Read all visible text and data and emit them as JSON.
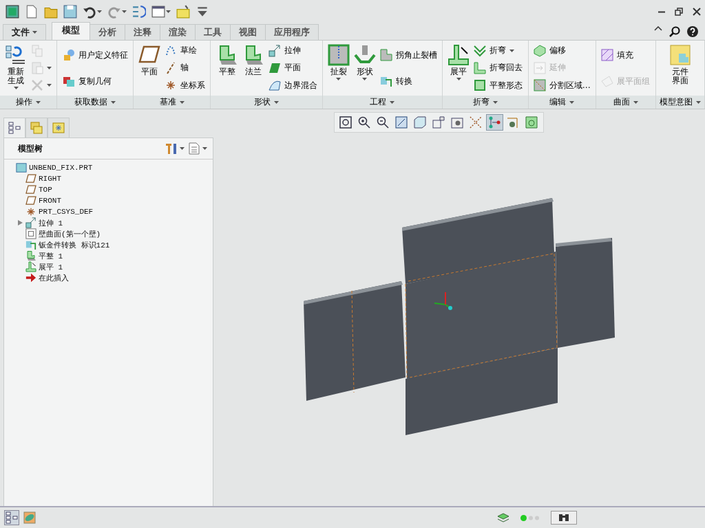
{
  "quick_access": {
    "buttons": [
      {
        "kind": "app",
        "dropdown": false
      },
      {
        "kind": "new",
        "dropdown": false
      },
      {
        "kind": "open",
        "dropdown": false
      },
      {
        "kind": "save",
        "dropdown": false
      },
      {
        "kind": "undo",
        "dropdown": true
      },
      {
        "kind": "redo",
        "dropdown": true
      },
      {
        "kind": "regen",
        "dropdown": false
      },
      {
        "kind": "windows",
        "dropdown": true
      },
      {
        "kind": "close",
        "dropdown": false
      },
      {
        "kind": "customize",
        "dropdown": false
      }
    ]
  },
  "tabs": [
    {
      "label": "文件",
      "selected": false,
      "kind": "file"
    },
    {
      "label": "模型",
      "selected": true,
      "kind": "tab"
    },
    {
      "label": "分析",
      "selected": false,
      "kind": "tab"
    },
    {
      "label": "注释",
      "selected": false,
      "kind": "tab"
    },
    {
      "label": "渲染",
      "selected": false,
      "kind": "tab"
    },
    {
      "label": "工具",
      "selected": false,
      "kind": "tab"
    },
    {
      "label": "视图",
      "selected": false,
      "kind": "tab"
    },
    {
      "label": "应用程序",
      "selected": false,
      "kind": "tab"
    }
  ],
  "ribbon": [
    {
      "label": "操作",
      "columns": [
        {
          "kind": "large",
          "label": "重新生成",
          "dropdown": true,
          "disabled": false
        },
        {
          "kind": "stack",
          "items": [
            {
              "dropdown": false,
              "disabled": true
            },
            {
              "dropdown": true,
              "disabled": true
            },
            {
              "dropdown": true,
              "disabled": true
            }
          ]
        }
      ]
    },
    {
      "label": "获取数据",
      "columns": [
        {
          "kind": "stack",
          "items": [
            {
              "label": "用户定义特征",
              "dropdown": false,
              "disabled": false
            },
            {
              "label": "复制几何",
              "dropdown": false,
              "disabled": false
            }
          ]
        }
      ]
    },
    {
      "label": "基准",
      "columns": [
        {
          "kind": "large",
          "label": "平面",
          "dropdown": false,
          "disabled": false
        },
        {
          "kind": "stack",
          "items": [
            {
              "label": "草绘",
              "dropdown": false,
              "disabled": false
            },
            {
              "label": "轴",
              "dropdown": false,
              "disabled": false
            },
            {
              "label": "坐标系",
              "dropdown": false,
              "disabled": false
            }
          ]
        }
      ]
    },
    {
      "label": "形状",
      "columns": [
        {
          "kind": "large",
          "label": "平整",
          "dropdown": false,
          "disabled": false
        },
        {
          "kind": "large",
          "label": "法兰",
          "dropdown": false,
          "disabled": false
        },
        {
          "kind": "stack",
          "items": [
            {
              "label": "拉伸",
              "dropdown": false,
              "disabled": false
            },
            {
              "label": "平面",
              "dropdown": false,
              "disabled": false
            },
            {
              "label": "边界混合",
              "dropdown": false,
              "disabled": false
            }
          ]
        }
      ]
    },
    {
      "label": "工程",
      "columns": [
        {
          "kind": "large",
          "label": "扯裂",
          "dropdown": true,
          "disabled": false
        },
        {
          "kind": "large",
          "label": "形状",
          "dropdown": true,
          "disabled": false
        },
        {
          "kind": "stack",
          "items": [
            {
              "label": "拐角止裂槽",
              "dropdown": false,
              "disabled": false
            },
            {
              "label": "转换",
              "dropdown": false,
              "disabled": false
            }
          ]
        }
      ]
    },
    {
      "label": "折弯",
      "columns": [
        {
          "kind": "large",
          "label": "展平",
          "dropdown": true,
          "disabled": false
        },
        {
          "kind": "stack",
          "items": [
            {
              "label": "折弯",
              "dropdown": true,
              "disabled": false
            },
            {
              "label": "折弯回去",
              "dropdown": false,
              "disabled": false
            },
            {
              "label": "平整形态",
              "dropdown": false,
              "disabled": false
            }
          ]
        }
      ]
    },
    {
      "label": "编辑",
      "columns": [
        {
          "kind": "stack",
          "items": [
            {
              "label": "偏移",
              "dropdown": false,
              "disabled": false
            },
            {
              "label": "延伸",
              "dropdown": false,
              "disabled": true
            },
            {
              "label": "分割区域…",
              "dropdown": false,
              "disabled": false
            }
          ]
        }
      ]
    },
    {
      "label": "曲面",
      "columns": [
        {
          "kind": "stack",
          "items": [
            {
              "label": "填充",
              "dropdown": false,
              "disabled": false
            },
            {
              "label": "展平面组",
              "dropdown": false,
              "disabled": true
            }
          ]
        }
      ]
    },
    {
      "label": "模型意图",
      "columns": [
        {
          "kind": "large",
          "label": "元件界面",
          "dropdown": false,
          "disabled": false
        }
      ]
    }
  ],
  "model_tree": {
    "tabs": [
      {
        "kind": "tree",
        "selected": true
      },
      {
        "kind": "folders",
        "selected": false
      },
      {
        "kind": "favorites",
        "selected": false
      }
    ],
    "title": "模型树",
    "items": [
      {
        "label": "UNBEND_FIX.PRT",
        "kind": "part",
        "children": [
          {
            "label": "RIGHT",
            "kind": "datum"
          },
          {
            "label": "TOP",
            "kind": "datum"
          },
          {
            "label": "FRONT",
            "kind": "datum"
          },
          {
            "label": "PRT_CSYS_DEF",
            "kind": "csys"
          },
          {
            "label": "拉伸 1",
            "kind": "extrude",
            "expanded": false
          },
          {
            "label": "壁曲面(第一个壁)",
            "kind": "wall"
          },
          {
            "label": "钣金件转换 标识121",
            "kind": "convert"
          },
          {
            "label": "平整 1",
            "kind": "flat"
          },
          {
            "label": "展平 1",
            "kind": "unbend"
          },
          {
            "label": "在此插入",
            "kind": "insert"
          }
        ]
      }
    ]
  },
  "view_toolbar": [
    {
      "kind": "refit",
      "selected": false
    },
    {
      "kind": "zoomin",
      "selected": false
    },
    {
      "kind": "zoomout",
      "selected": false
    },
    {
      "kind": "repaint",
      "selected": false
    },
    {
      "kind": "display",
      "selected": false
    },
    {
      "kind": "views",
      "selected": false
    },
    {
      "kind": "orient",
      "selected": false
    },
    {
      "kind": "datums",
      "selected": false
    },
    {
      "kind": "annot",
      "selected": true
    },
    {
      "kind": "spin",
      "selected": false
    },
    {
      "kind": "appear",
      "selected": false
    }
  ],
  "status_bar": {
    "left": [
      {
        "kind": "tree",
        "selected": true
      },
      {
        "kind": "browser",
        "selected": false
      }
    ]
  }
}
